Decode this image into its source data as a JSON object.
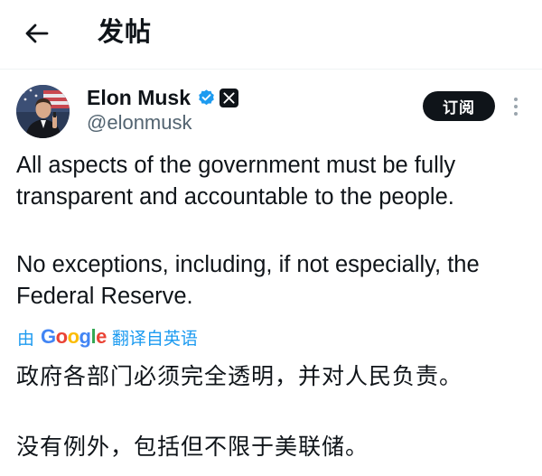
{
  "header": {
    "title": "发帖",
    "back_icon": "arrow-left-icon"
  },
  "author": {
    "name": "Elon Musk",
    "handle": "@elonmusk",
    "verified_icon": "verified-badge-icon",
    "affiliate_icon": "x-logo-icon",
    "verified_color": "#1d9bf0"
  },
  "actions": {
    "subscribe_label": "订阅",
    "more_icon": "more-vertical-icon"
  },
  "tweet": {
    "paragraphs": [
      "All aspects of the government must be fully transparent and accountable to the people.",
      "No exceptions, including, if not especially, the Federal Reserve."
    ]
  },
  "translation": {
    "prefix": "由",
    "provider_letters": [
      "G",
      "o",
      "o",
      "g",
      "l",
      "e"
    ],
    "suffix": "翻译自英语",
    "paragraphs": [
      "政府各部门必须完全透明，并对人民负责。",
      "没有例外，包括但不限于美联储。"
    ]
  },
  "colors": {
    "text_primary": "#0f1419",
    "text_secondary": "#536471",
    "accent": "#1d9bf0",
    "divider": "#eff3f4"
  }
}
